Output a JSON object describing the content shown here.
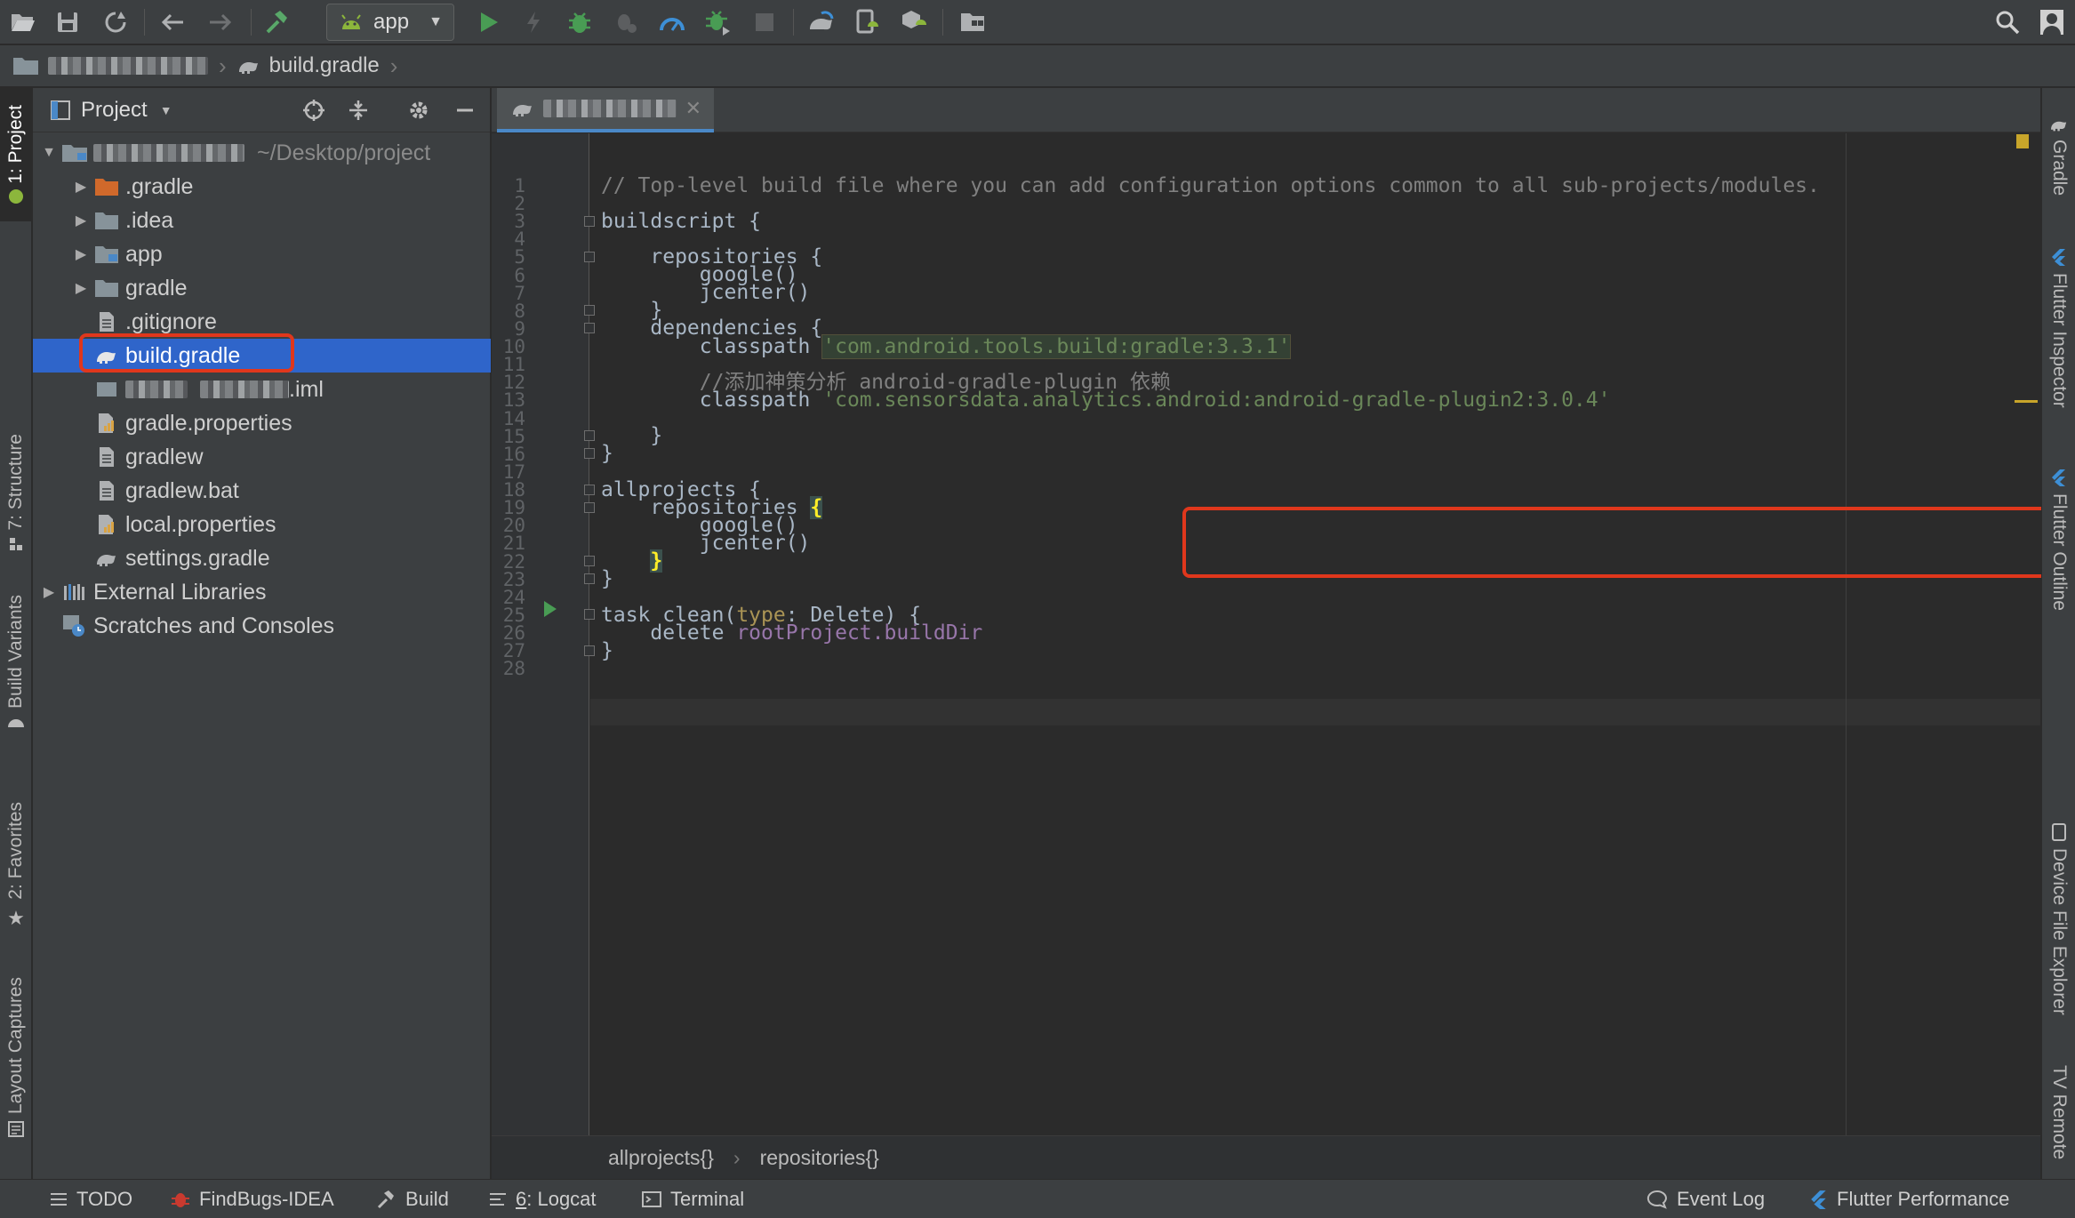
{
  "toolbar": {
    "run_config": "app",
    "icons": [
      "open-folder-icon",
      "save-icon",
      "sync-icon",
      "back-icon",
      "forward-icon",
      "build-hammer-icon",
      "android-icon",
      "run-icon",
      "apply-changes-icon",
      "debug-icon",
      "attach-debugger-icon",
      "profile-icon",
      "debug-attach-icon",
      "stop-icon",
      "gradle-sync-icon",
      "avd-manager-icon",
      "sdk-manager-icon",
      "project-structure-icon",
      "search-icon",
      "user-icon"
    ]
  },
  "breadcrumb": {
    "file": "build.gradle"
  },
  "left_stripe": {
    "tabs": [
      "1: Project",
      "7: Structure",
      "Build Variants",
      "2: Favorites",
      "Layout Captures"
    ]
  },
  "right_stripe": {
    "tabs": [
      "Gradle",
      "Flutter Inspector",
      "Flutter Outline",
      "Device File Explorer",
      "TV Remote"
    ]
  },
  "project_panel": {
    "title": "Project",
    "root_path": "~/Desktop/project",
    "items": [
      {
        "label": ".gradle"
      },
      {
        "label": ".idea"
      },
      {
        "label": "app"
      },
      {
        "label": "gradle"
      },
      {
        "label": ".gitignore"
      },
      {
        "label": "build.gradle"
      },
      {
        "label": ".iml"
      },
      {
        "label": "gradle.properties"
      },
      {
        "label": "gradlew"
      },
      {
        "label": "gradlew.bat"
      },
      {
        "label": "local.properties"
      },
      {
        "label": "settings.gradle"
      },
      {
        "label": "External Libraries"
      },
      {
        "label": "Scratches and Consoles"
      }
    ]
  },
  "editor": {
    "line_numbers": [
      "1",
      "2",
      "3",
      "4",
      "5",
      "6",
      "7",
      "8",
      "9",
      "10",
      "11",
      "12",
      "13",
      "14",
      "15",
      "16",
      "17",
      "18",
      "19",
      "20",
      "21",
      "22",
      "23",
      "24",
      "25",
      "26",
      "27",
      "28"
    ],
    "code": {
      "l1": "// Top-level build file where you can add configuration options common to all sub-projects/modules.",
      "l3": "buildscript {",
      "l5": "    repositories {",
      "l6": "        google()",
      "l7": "        jcenter()",
      "l8": "    }",
      "l9": "    dependencies {",
      "l10_kw": "        classpath ",
      "l10_str": "'com.android.tools.build:gradle:3.3.1'",
      "l12": "        //添加神策分析 android-gradle-plugin 依赖",
      "l13_kw": "        classpath ",
      "l13_str": "'com.sensorsdata.analytics.android:android-gradle-plugin2:3.0.4'",
      "l15": "    }",
      "l16": "}",
      "l18": "allprojects {",
      "l19_a": "    repositories ",
      "l19_b": "{",
      "l20": "        google()",
      "l21": "        jcenter()",
      "l22_a": "    ",
      "l22_b": "}",
      "l23": "}",
      "l25_a": "task clean(",
      "l25_b": "type",
      "l25_c": ": Delete) {",
      "l26_a": "    delete ",
      "l26_b": "rootProject.buildDir",
      "l27": "}"
    },
    "crumbs": [
      "allprojects{}",
      "repositories{}"
    ]
  },
  "statusbar": {
    "todo": "TODO",
    "findbugs": "FindBugs-IDEA",
    "build": "Build",
    "logcat_num": "6",
    "logcat": ": Logcat",
    "terminal": "Terminal",
    "event_log": "Event Log",
    "flutter_perf": "Flutter Performance"
  },
  "colors": {
    "selection": "#2f65ca",
    "annotation_red": "#e0371c",
    "string_green": "#6a8759",
    "comment_gray": "#808080"
  }
}
